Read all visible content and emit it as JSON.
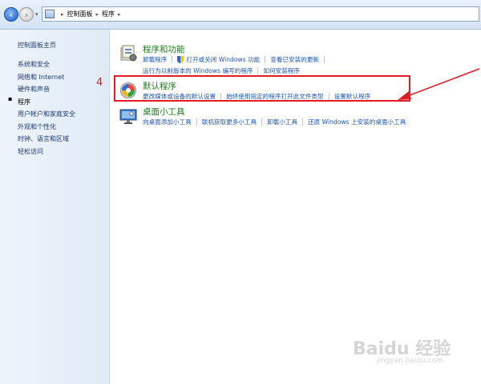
{
  "address": {
    "crumbs": [
      "控制面板",
      "程序"
    ]
  },
  "sidebar": {
    "home": "控制面板主页",
    "items": [
      {
        "label": "系统和安全"
      },
      {
        "label": "网络和 Internet"
      },
      {
        "label": "硬件和声音"
      },
      {
        "label": "程序",
        "active": true
      },
      {
        "label": "用户帐户和家庭安全"
      },
      {
        "label": "外观和个性化"
      },
      {
        "label": "时钟、语言和区域"
      },
      {
        "label": "轻松访问"
      }
    ]
  },
  "groups": {
    "programs": {
      "title": "程序和功能",
      "links_row1": [
        "卸载程序",
        "打开或关闭 Windows 功能",
        "查看已安装的更新"
      ],
      "links_row2": [
        "运行为以前版本的 Windows 编写的程序",
        "如何安装程序"
      ]
    },
    "defaults": {
      "title": "默认程序",
      "links_row1": [
        "更改媒体或设备的默认设置",
        "始终使用指定的程序打开此文件类型",
        "设置默认程序"
      ]
    },
    "gadgets": {
      "title": "桌面小工具",
      "links_row1": [
        "向桌面添加小工具",
        "联机获取更多小工具",
        "卸载小工具",
        "还原 Windows 上安装的桌面小工具"
      ]
    }
  },
  "annotation": {
    "step_number": "4",
    "color": "#e31b23"
  },
  "watermark": {
    "brand": "Baidu 经验",
    "url": "jingyan.baidu.com"
  },
  "icons": {
    "back": "back-arrow-icon",
    "forward": "forward-arrow-icon",
    "control_panel": "control-panel-icon",
    "programs": "programs-features-icon",
    "defaults": "default-programs-icon",
    "gadgets": "desktop-gadgets-icon",
    "shield": "uac-shield-icon"
  }
}
